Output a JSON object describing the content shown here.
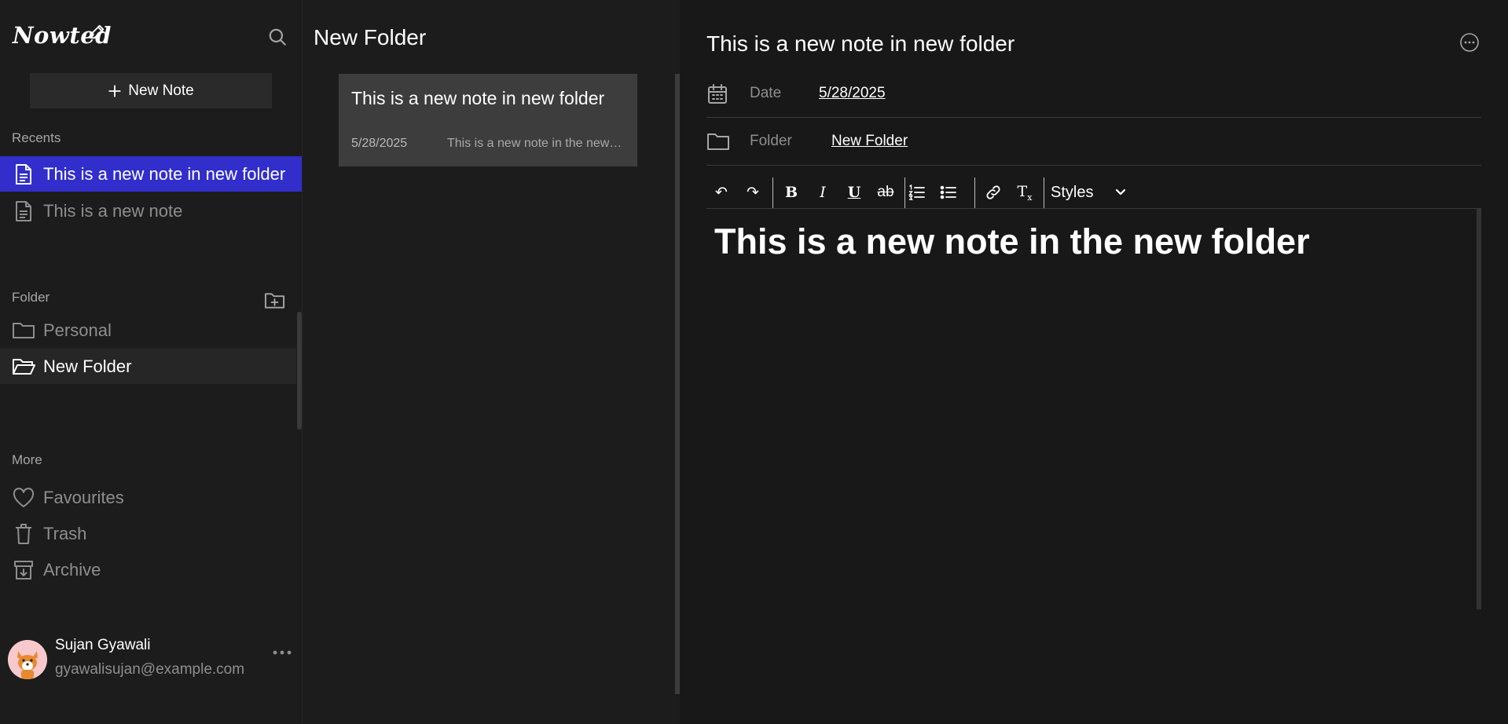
{
  "app": {
    "logo": "Nowted",
    "new_note_label": "New Note"
  },
  "sidebar": {
    "recents_label": "Recents",
    "recents": [
      {
        "label": "This is a new note in new folder",
        "icon": "document-icon"
      },
      {
        "label": "This is a new note",
        "icon": "document-icon"
      }
    ],
    "folders_label": "Folder",
    "folders": [
      {
        "label": "Personal",
        "icon": "folder-icon"
      },
      {
        "label": "New Folder",
        "icon": "folder-open-icon"
      }
    ],
    "more_label": "More",
    "more": [
      {
        "label": "Favourites",
        "icon": "heart-icon"
      },
      {
        "label": "Trash",
        "icon": "trash-icon"
      },
      {
        "label": "Archive",
        "icon": "archive-icon"
      }
    ],
    "user": {
      "name": "Sujan Gyawali",
      "email": "gyawalisujan@example.com"
    }
  },
  "list": {
    "folder_title": "New Folder",
    "notes": [
      {
        "title": "This is a new note in new folder",
        "date": "5/28/2025",
        "preview": "This is a new note in the new…"
      }
    ]
  },
  "editor": {
    "title": "This is a new note in new folder",
    "date_label": "Date",
    "date_value": "5/28/2025",
    "folder_label": "Folder",
    "folder_value": "New Folder",
    "toolbar": {
      "styles_label": "Styles"
    },
    "content_heading": "This is a new note in the new folder"
  },
  "colors": {
    "accent": "#312ecb",
    "background": "#181818",
    "sidebar": "#1c1c1c",
    "card": "#3d3d3d"
  }
}
